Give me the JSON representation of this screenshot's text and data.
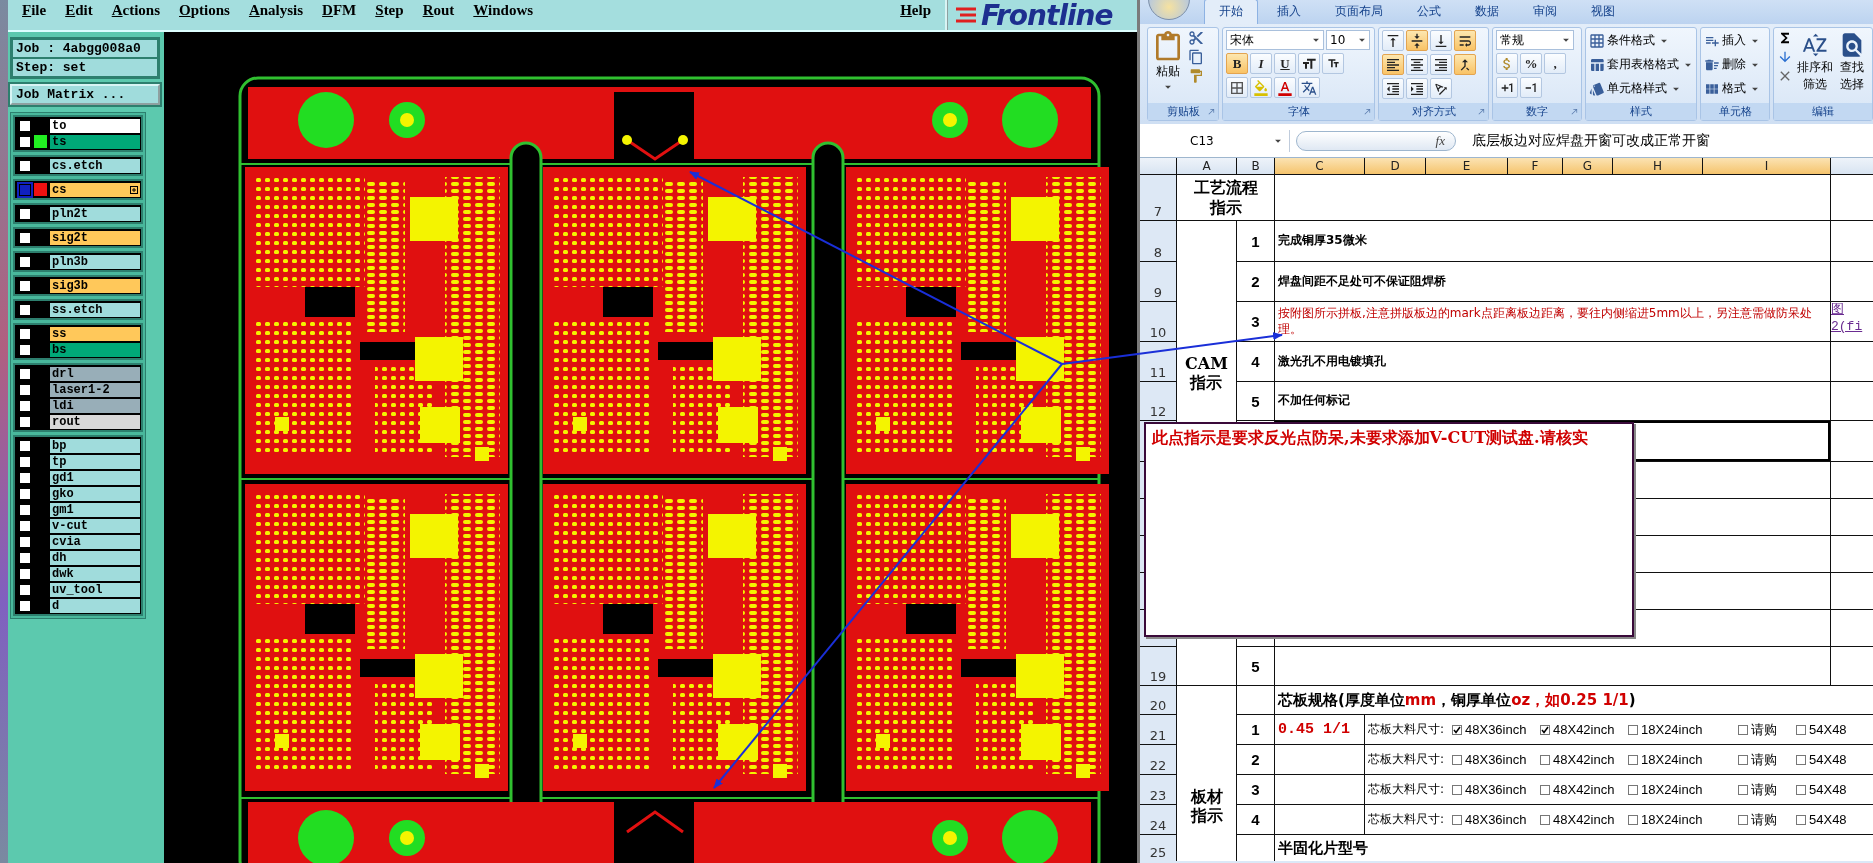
{
  "cam": {
    "menu": [
      {
        "label": "File"
      },
      {
        "label": "Edit"
      },
      {
        "label": "Actions"
      },
      {
        "label": "Options"
      },
      {
        "label": "Analysis"
      },
      {
        "label": "DFM"
      },
      {
        "label": "Step"
      },
      {
        "label": "Rout"
      },
      {
        "label": "Windows"
      }
    ],
    "help": "Help",
    "logo": "Frontline",
    "job": "Job : 4abgg008a0",
    "step": "Step: set",
    "job_matrix": "Job Matrix ...",
    "layer_groups": [
      {
        "layers": [
          {
            "name": "to",
            "color": "#ffffff",
            "selected": false
          },
          {
            "name": "ts",
            "color": "#00a878",
            "indicator": {
              "color": "#22ee22"
            },
            "selected": false
          }
        ]
      },
      {
        "layers": [
          {
            "name": "cs.etch",
            "color": "#a0dcdc",
            "selected": false
          }
        ]
      },
      {
        "layers": [
          {
            "name": "cs",
            "color": "#ffc85a",
            "indicator": {
              "color": "#ee1111"
            },
            "selected": true,
            "flagged": true
          }
        ]
      },
      {
        "layers": [
          {
            "name": "pln2t",
            "color": "#a0dcdc",
            "selected": false
          }
        ]
      },
      {
        "layers": [
          {
            "name": "sig2t",
            "color": "#ffc85a",
            "selected": false
          }
        ]
      },
      {
        "layers": [
          {
            "name": "pln3b",
            "color": "#a0dcdc",
            "selected": false
          }
        ]
      },
      {
        "layers": [
          {
            "name": "sig3b",
            "color": "#ffc85a",
            "selected": false
          }
        ]
      },
      {
        "layers": [
          {
            "name": "ss.etch",
            "color": "#a0dcdc",
            "selected": false
          }
        ]
      },
      {
        "layers": [
          {
            "name": "ss",
            "color": "#ffc85a",
            "selected": false
          },
          {
            "name": "bs",
            "color": "#00a878",
            "selected": false
          }
        ]
      },
      {
        "layers": [
          {
            "name": "drl",
            "color": "#98aeb8",
            "selected": false
          },
          {
            "name": "laser1-2",
            "color": "#98aeb8",
            "selected": false
          },
          {
            "name": "ldi",
            "color": "#98aeb8",
            "selected": false
          },
          {
            "name": "rout",
            "color": "#d8d8d8",
            "selected": false
          }
        ]
      },
      {
        "layers": [
          {
            "name": "bp",
            "color": "#a0dcdc",
            "selected": false
          },
          {
            "name": "tp",
            "color": "#a0dcdc",
            "selected": false
          },
          {
            "name": "gd1",
            "color": "#a0dcdc",
            "selected": false
          },
          {
            "name": "gko",
            "color": "#a0dcdc",
            "selected": false
          },
          {
            "name": "gm1",
            "color": "#a0dcdc",
            "selected": false
          },
          {
            "name": "v-cut",
            "color": "#a0dcdc",
            "selected": false
          },
          {
            "name": "cvia",
            "color": "#a0dcdc",
            "selected": false
          },
          {
            "name": "dh",
            "color": "#a0dcdc",
            "selected": false
          },
          {
            "name": "dwk",
            "color": "#a0dcdc",
            "selected": false
          },
          {
            "name": "uv_tool",
            "color": "#a0dcdc",
            "selected": false
          },
          {
            "name": "d",
            "color": "#a0dcdc",
            "selected": false
          }
        ]
      }
    ]
  },
  "excel": {
    "ribbon": {
      "tabs": [
        {
          "label": "开始",
          "selected": true
        },
        {
          "label": "插入",
          "selected": false
        },
        {
          "label": "页面布局",
          "selected": false
        },
        {
          "label": "公式",
          "selected": false
        },
        {
          "label": "数据",
          "selected": false
        },
        {
          "label": "审阅",
          "selected": false
        },
        {
          "label": "视图",
          "selected": false
        }
      ],
      "paste": "粘贴",
      "font_name": "宋体",
      "font_size": "10",
      "format_buttons": [
        {
          "label": "B",
          "selected": true
        },
        {
          "label": "I",
          "selected": false
        },
        {
          "label": "U",
          "selected": false
        }
      ],
      "vertical_align": [
        {
          "kind": "top",
          "selected": false
        },
        {
          "kind": "middle",
          "selected": true
        },
        {
          "kind": "bottom",
          "selected": false
        }
      ],
      "horizontal_align": [
        {
          "kind": "left",
          "selected": true
        },
        {
          "kind": "center",
          "selected": false
        },
        {
          "kind": "right",
          "selected": false
        }
      ],
      "wrap_selected": true,
      "merge_selected": true,
      "number_format": "常规",
      "number_symbols": [
        "%",
        ","
      ],
      "styles": [
        "条件格式",
        "套用表格格式",
        "单元格样式"
      ],
      "cells": [
        "插入",
        "删除",
        "格式"
      ],
      "sort": [
        "排序和",
        "筛选"
      ],
      "find": [
        "查找",
        "选择"
      ],
      "groups": [
        "剪贴板",
        "字体",
        "对齐方式",
        "数字",
        "样式",
        "单元格",
        "编辑"
      ]
    },
    "name_box": "C13",
    "function_label": "fx",
    "formula": "底层板边对应焊盘开窗可改成正常开窗",
    "columns": [
      {
        "label": "A",
        "selected": false
      },
      {
        "label": "B",
        "selected": false
      },
      {
        "label": "C",
        "selected": true
      },
      {
        "label": "D",
        "selected": true
      },
      {
        "label": "E",
        "selected": true
      },
      {
        "label": "F",
        "selected": true
      },
      {
        "label": "G",
        "selected": true
      },
      {
        "label": "H",
        "selected": true
      },
      {
        "label": "I",
        "selected": true
      }
    ],
    "row_numbers": [
      "7",
      "8",
      "9",
      "10",
      "11",
      "12",
      "19",
      "20",
      "21",
      "22",
      "23",
      "24",
      "25"
    ],
    "process_label": [
      "工艺流程",
      "指示"
    ],
    "cam_label": [
      "CAM",
      "指示"
    ],
    "board_label": [
      "板材",
      "指示"
    ],
    "cam_items": [
      {
        "number": "1",
        "text": "完成铜厚35微米",
        "kind": "normal"
      },
      {
        "number": "2",
        "text": "焊盘间距不足处可不保证阻焊桥",
        "kind": "normal"
      },
      {
        "number": "3",
        "text": "按附图所示拼板,注意拼版板边的mark点距离板边距离，要往内侧缩进5mm以上，另注意需做防呆处理。",
        "kind": "warning"
      },
      {
        "number": "4",
        "text": "激光孔不用电镀填孔",
        "kind": "normal"
      },
      {
        "number": "5",
        "text": "不加任何标记",
        "kind": "normal"
      }
    ],
    "figure_link": [
      "图",
      "2(fi"
    ],
    "last_cam_number": "5",
    "core_spec": [
      {
        "text": "芯板规格(厚度单位",
        "highlight": false
      },
      {
        "text": "mm",
        "highlight": true
      },
      {
        "text": "，铜厚单位",
        "highlight": false
      },
      {
        "text": "oz，如0.25 1/1",
        "highlight": true
      },
      {
        "text": ")",
        "highlight": false
      }
    ],
    "core_rows": [
      {
        "number": "1",
        "thickness": "0.45 1/1",
        "label": "芯板大料尺寸:",
        "options": [
          {
            "label": "48X36inch",
            "checked": true
          },
          {
            "label": "48X42inch",
            "checked": true
          },
          {
            "label": "18X24inch",
            "checked": false
          },
          {
            "label": "请购",
            "checked": false
          },
          {
            "label": "54X48",
            "checked": false
          }
        ]
      },
      {
        "number": "2",
        "label": "芯板大料尺寸:",
        "options": [
          {
            "label": "48X36inch",
            "checked": false
          },
          {
            "label": "48X42inch",
            "checked": false
          },
          {
            "label": "18X24inch",
            "checked": false
          },
          {
            "label": "请购",
            "checked": false
          },
          {
            "label": "54X48",
            "checked": false
          }
        ]
      },
      {
        "number": "3",
        "label": "芯板大料尺寸:",
        "options": [
          {
            "label": "48X36inch",
            "checked": false
          },
          {
            "label": "48X42inch",
            "checked": false
          },
          {
            "label": "18X24inch",
            "checked": false
          },
          {
            "label": "请购",
            "checked": false
          },
          {
            "label": "54X48",
            "checked": false
          }
        ]
      },
      {
        "number": "4",
        "label": "芯板大料尺寸:",
        "options": [
          {
            "label": "48X36inch",
            "checked": false
          },
          {
            "label": "48X42inch",
            "checked": false
          },
          {
            "label": "18X24inch",
            "checked": false
          },
          {
            "label": "请购",
            "checked": false
          },
          {
            "label": "54X48",
            "checked": false
          }
        ]
      }
    ],
    "prepreg_label": "半固化片型号",
    "callout": "此点指示是要求反光点防呆,未要求添加V-CUT测试盘.请核实"
  }
}
